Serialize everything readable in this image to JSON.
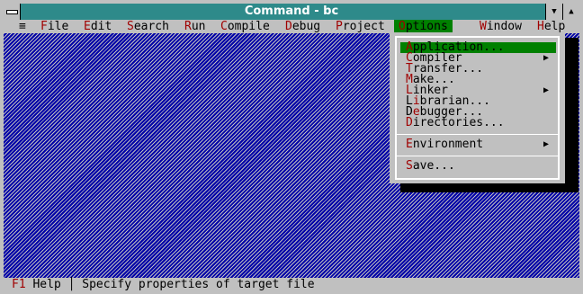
{
  "window": {
    "title": "Command - bc"
  },
  "menubar": {
    "system": "≡",
    "items": [
      {
        "hk": "F",
        "rest": "ile"
      },
      {
        "hk": "E",
        "rest": "dit"
      },
      {
        "hk": "S",
        "rest": "earch"
      },
      {
        "hk": "R",
        "rest": "un"
      },
      {
        "hk": "C",
        "rest": "ompile"
      },
      {
        "hk": "D",
        "rest": "ebug"
      },
      {
        "hk": "P",
        "rest": "roject"
      },
      {
        "hk": "O",
        "rest": "ptions"
      },
      {
        "hk": "W",
        "rest": "indow"
      },
      {
        "hk": "H",
        "rest": "elp"
      }
    ]
  },
  "options_menu": {
    "items": [
      {
        "hk": "A",
        "rest": "pplication...",
        "submenu": false
      },
      {
        "hk": "C",
        "rest": "ompiler",
        "submenu": true
      },
      {
        "hk": "T",
        "rest": "ransfer...",
        "submenu": false
      },
      {
        "hk": "M",
        "rest": "ake...",
        "submenu": false
      },
      {
        "hk": "L",
        "rest": "inker",
        "submenu": true
      },
      {
        "pre": "L",
        "hk": "i",
        "rest": "brarian...",
        "submenu": false
      },
      {
        "pre": "D",
        "hk": "e",
        "rest": "bugger...",
        "submenu": false
      },
      {
        "hk": "D",
        "rest": "irectories...",
        "submenu": false
      },
      {
        "hk": "E",
        "rest": "nvironment",
        "submenu": true
      },
      {
        "hk": "S",
        "rest": "ave...",
        "submenu": false
      }
    ]
  },
  "statusbar": {
    "key": "F1",
    "key_label": " Help",
    "sep": " │ ",
    "message": "Specify properties of target file"
  },
  "colors": {
    "desktop": "#0000a8",
    "highlight": "#008000",
    "hotkey": "#a00000",
    "title": "#2e8a8a"
  }
}
